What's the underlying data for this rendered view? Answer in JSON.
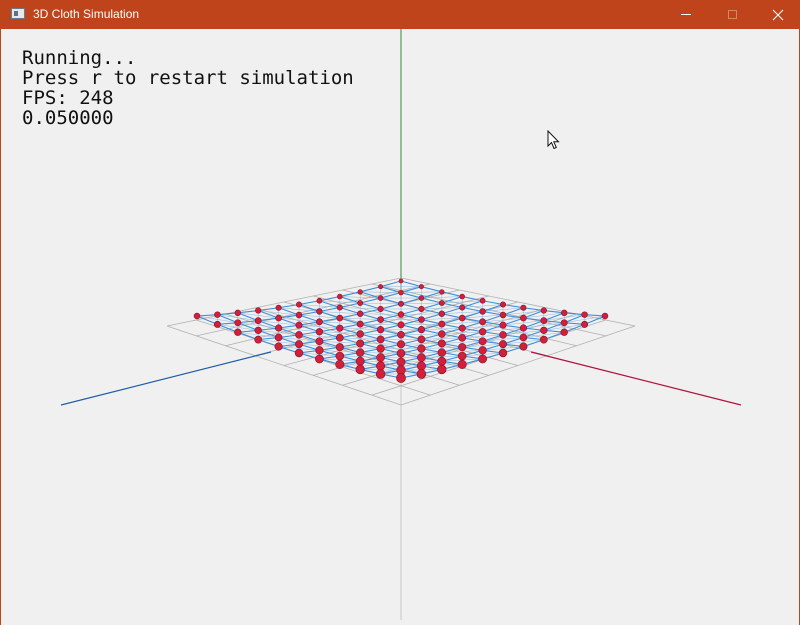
{
  "window": {
    "title": "3D Cloth Simulation",
    "titlebar_color": "#c0441b",
    "canvas_background": "#f0f0f0"
  },
  "hud": {
    "status": "Running...",
    "hint": "Press r to restart simulation",
    "fps": "FPS: 248",
    "timestep": "0.050000"
  },
  "scene": {
    "cloth_grid_size": 11,
    "axis_colors": {
      "x": "#b2103c",
      "y": "#2e8b3c",
      "z": "#1f5fa8"
    },
    "cloth_line_color": "#3a8fd8",
    "node_color": "#d21f3c",
    "floor_grid_color": "#b0b0b0"
  },
  "icons": {
    "app": "app-icon",
    "minimize": "minimize-icon",
    "maximize": "maximize-icon",
    "close": "close-icon",
    "cursor": "mouse-cursor-icon"
  }
}
